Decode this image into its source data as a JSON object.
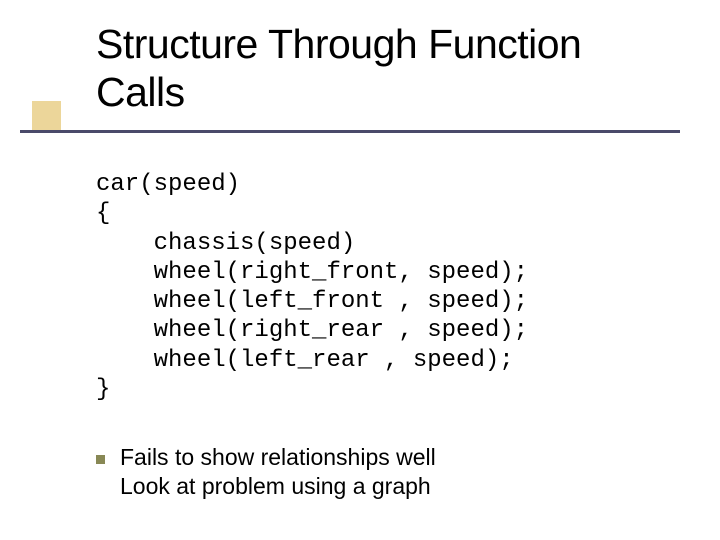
{
  "title": "Structure Through Function Calls",
  "code": "car(speed)\n{\n    chassis(speed)\n    wheel(right_front, speed);\n    wheel(left_front , speed);\n    wheel(right_rear , speed);\n    wheel(left_rear , speed);\n}",
  "caption_line1": "Fails to show relationships well",
  "caption_line2": "Look at problem using a graph"
}
